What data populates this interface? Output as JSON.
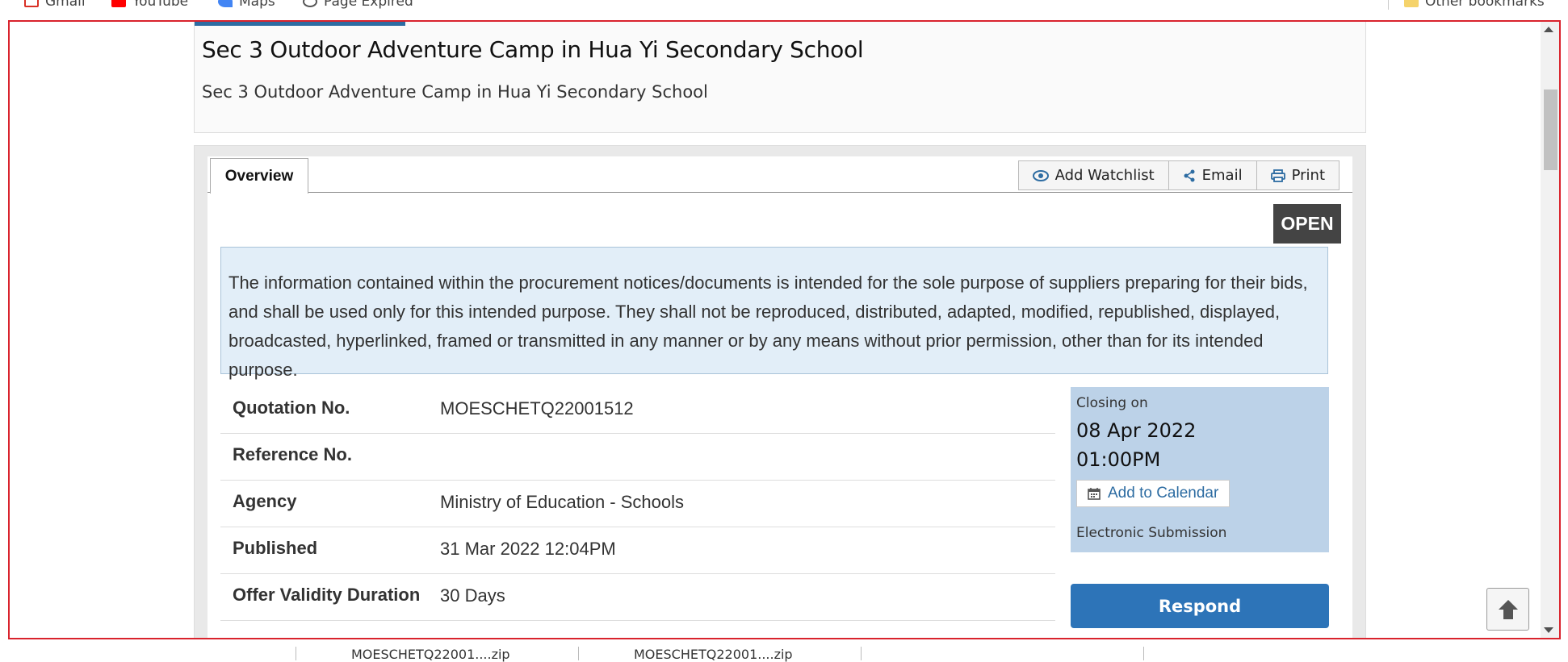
{
  "bookmarks": {
    "items": [
      {
        "label": "Gmail",
        "color": "#d93025"
      },
      {
        "label": "YouTube",
        "color": "#ff0000"
      },
      {
        "label": "Maps",
        "color": "#4285f4"
      },
      {
        "label": "Page Expired",
        "color": "#555555"
      }
    ],
    "other_label": "Other bookmarks"
  },
  "header": {
    "title": "Sec 3 Outdoor Adventure Camp in Hua Yi Secondary School",
    "subtitle": "Sec 3 Outdoor Adventure Camp in Hua Yi Secondary School"
  },
  "tabs": [
    {
      "label": "Overview",
      "active": true
    }
  ],
  "actions": {
    "watchlist": "Add Watchlist",
    "email": "Email",
    "print": "Print"
  },
  "status": {
    "label": "OPEN"
  },
  "notice": "The information contained within the procurement notices/documents is intended for the sole purpose of suppliers preparing for their bids, and shall be used only for this intended purpose. They shall not be reproduced, distributed, adapted, modified, republished, displayed, broadcasted, hyperlinked, framed or transmitted in any manner or by any means without prior permission, other than for its intended purpose.",
  "details": [
    {
      "key": "Quotation No.",
      "value": "MOESCHETQ22001512"
    },
    {
      "key": "Reference No.",
      "value": ""
    },
    {
      "key": "Agency",
      "value": "Ministry of Education - Schools"
    },
    {
      "key": "Published",
      "value": "31 Mar 2022 12:04PM"
    },
    {
      "key": "Offer Validity Duration",
      "value": "30 Days"
    }
  ],
  "closing": {
    "label": "Closing on",
    "date": "08 Apr 2022",
    "time": "01:00PM",
    "calendar_label": "Add to Calendar",
    "submission": "Electronic Submission"
  },
  "respond_label": "Respond",
  "downloads": {
    "items": [
      "MOESCHETQ22001....zip",
      "MOESCHETQ22001....zip"
    ]
  },
  "colors": {
    "accent": "#2d6ca2",
    "respond": "#2d74b8",
    "closing_bg": "#bcd2e8",
    "notice_bg": "#e2eef8",
    "badge_bg": "#444444",
    "frame": "#d9232d"
  }
}
